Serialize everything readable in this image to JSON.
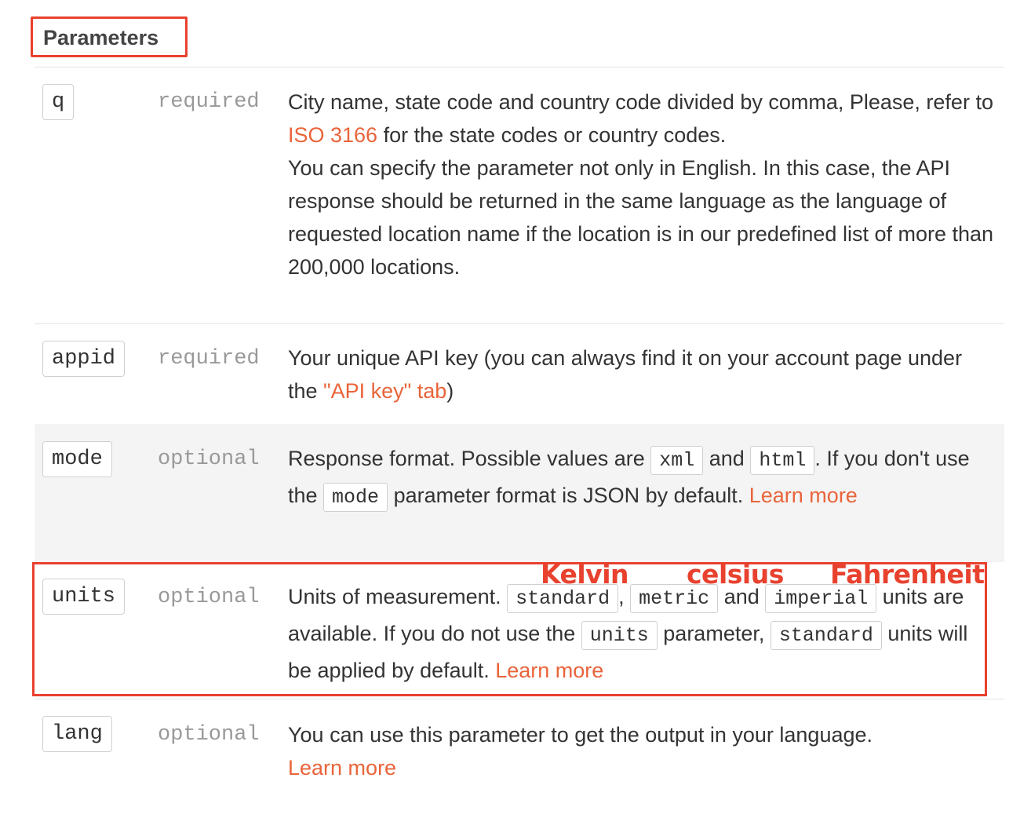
{
  "heading": "Parameters",
  "params": [
    {
      "name": "q",
      "requirement": "required",
      "desc": {
        "line1": "City name, state code and country code divided by comma, Please, refer to ",
        "link1": "ISO 3166",
        "line2": " for the state codes or country codes.",
        "line3": "You can specify the parameter not only in English. In this case, the API response should be returned in the same language as the language of requested location name if the location is in our predefined list of more than 200,000 locations."
      }
    },
    {
      "name": "appid",
      "requirement": "required",
      "desc": {
        "text1": "Your unique API key (you can always find it on your account page under the ",
        "link1": "\"API key\" tab",
        "text2": ")"
      }
    },
    {
      "name": "mode",
      "requirement": "optional",
      "desc": {
        "text1": "Response format. Possible values are ",
        "code1": "xml",
        "text2": " and ",
        "code2": "html",
        "text3": ". If you don't use the ",
        "code3": "mode",
        "text4": " parameter format is JSON by default. ",
        "link1": "Learn more"
      }
    },
    {
      "name": "units",
      "requirement": "optional",
      "desc": {
        "text1": "Units of measurement. ",
        "code1": "standard",
        "text2": ", ",
        "code2": "metric",
        "text3": " and ",
        "code3": "imperial",
        "text4": " units are available. If you do not use the ",
        "code4": "units",
        "text5": " parameter, ",
        "code5": "standard",
        "text6": " units will be applied by default. ",
        "link1": "Learn more"
      }
    },
    {
      "name": "lang",
      "requirement": "optional",
      "desc": {
        "text1": "You can use this parameter to get the output in your language.",
        "link1": "Learn more"
      }
    }
  ],
  "annotations": {
    "kelvin": "Kelvin",
    "celsius": "celsius",
    "fahrenheit": "Fahrenheit"
  },
  "colors": {
    "link": "#e9643a",
    "highlight": "#e8412e",
    "shaded_row": "#f4f4f4"
  }
}
